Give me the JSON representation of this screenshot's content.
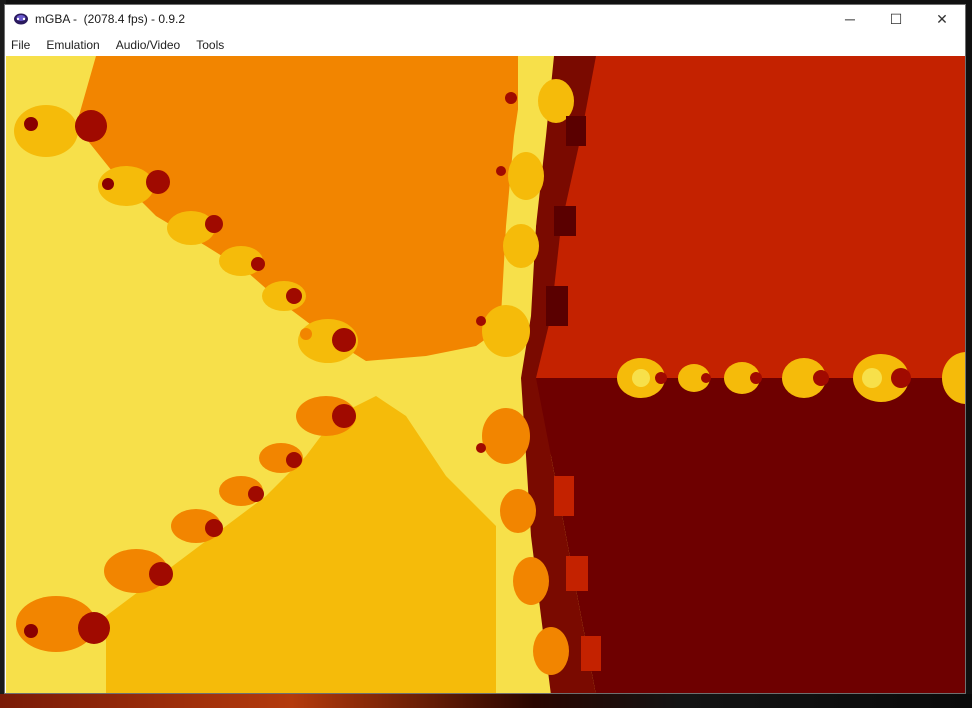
{
  "window": {
    "title": "mGBA -  (2078.4 fps) - 0.9.2",
    "app_icon": "mgba-icon",
    "controls": {
      "minimize": "─",
      "maximize": "☐",
      "close": "✕"
    }
  },
  "menu": {
    "items": [
      "File",
      "Emulation",
      "Audio/Video",
      "Tools"
    ]
  },
  "screen": {
    "content": "fractal-render",
    "palette": {
      "pale_yellow": "#f7e04a",
      "gold": "#f5bb0a",
      "orange": "#f28500",
      "red_orange": "#c42200",
      "crimson": "#b01800",
      "dark_red": "#6e0000",
      "maroon": "#5a0000"
    }
  }
}
